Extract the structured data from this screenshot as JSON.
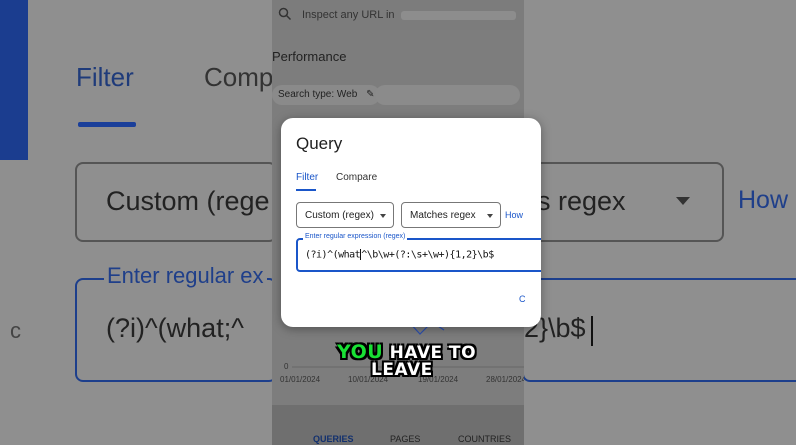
{
  "background": {
    "tabs": [
      "Filter",
      "Compa"
    ],
    "dropdown_left": "Custom (rege",
    "dropdown_right": "es regex",
    "help_link": "How",
    "field_label": "Enter regular ex",
    "field_value_left": "(?i)^(what;^",
    "field_value_right": "2}\\b$",
    "stray_letter": "c"
  },
  "phone": {
    "search_placeholder": "Inspect any URL in",
    "section_title": "Performance",
    "chip_label": "Search type: Web",
    "chart": {
      "y_tick": "0",
      "x_ticks": [
        "01/01/2024",
        "10/01/2024",
        "19/01/2024",
        "28/01/2024"
      ]
    },
    "bottom_nav": [
      "QUERIES",
      "PAGES",
      "COUNTRIES"
    ]
  },
  "dialog": {
    "title": "Query",
    "tabs": [
      "Filter",
      "Compare"
    ],
    "dropdown_type": "Custom (regex)",
    "dropdown_match": "Matches regex",
    "help_link": "How",
    "field_label": "Enter regular expression (regex)",
    "field_value_before_cursor": "(?i)^(what",
    "field_value_after_cursor": "^\\b\\w+(?:\\s+\\w+){1,2}\\b$",
    "partial_button": "C"
  },
  "caption": {
    "highlight": "YOU",
    "line1_rest": "HAVE TO",
    "line2": "LEAVE"
  },
  "colors": {
    "accent_blue": "#1a56c9",
    "caption_highlight": "#19e034"
  }
}
